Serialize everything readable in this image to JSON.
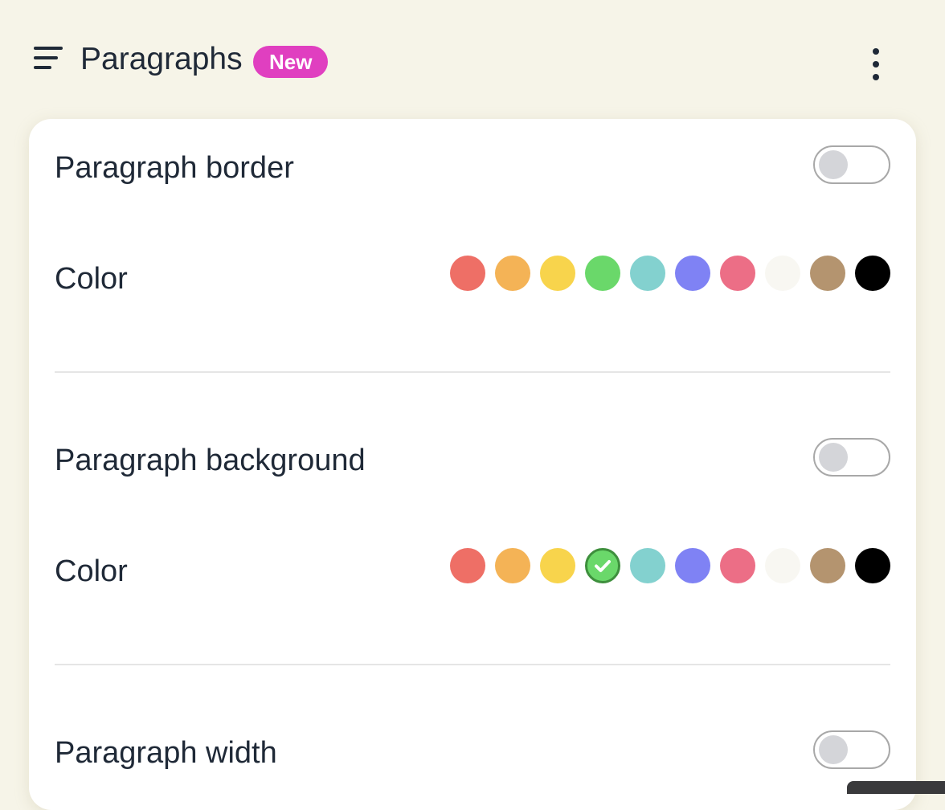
{
  "header": {
    "title": "Paragraphs",
    "badge": "New",
    "menu_icon": "hamburger-menu-icon",
    "more_icon": "vertical-dots-icon"
  },
  "colors": {
    "background": "#f6f4e8",
    "card": "#ffffff",
    "badge": "#e03fc0",
    "text": "#1f2937"
  },
  "sections": [
    {
      "label": "Paragraph border",
      "toggle_on": false,
      "color_label": "Color",
      "selected_color_index": null
    },
    {
      "label": "Paragraph background",
      "toggle_on": false,
      "color_label": "Color",
      "selected_color_index": 3
    },
    {
      "label": "Paragraph width",
      "toggle_on": false
    }
  ],
  "palette": [
    "#ee6f66",
    "#f4b356",
    "#f8d44c",
    "#6ad86a",
    "#83d1cf",
    "#7f82f4",
    "#ec6e86",
    "#f8f7f2",
    "#b4946f",
    "#000000"
  ]
}
